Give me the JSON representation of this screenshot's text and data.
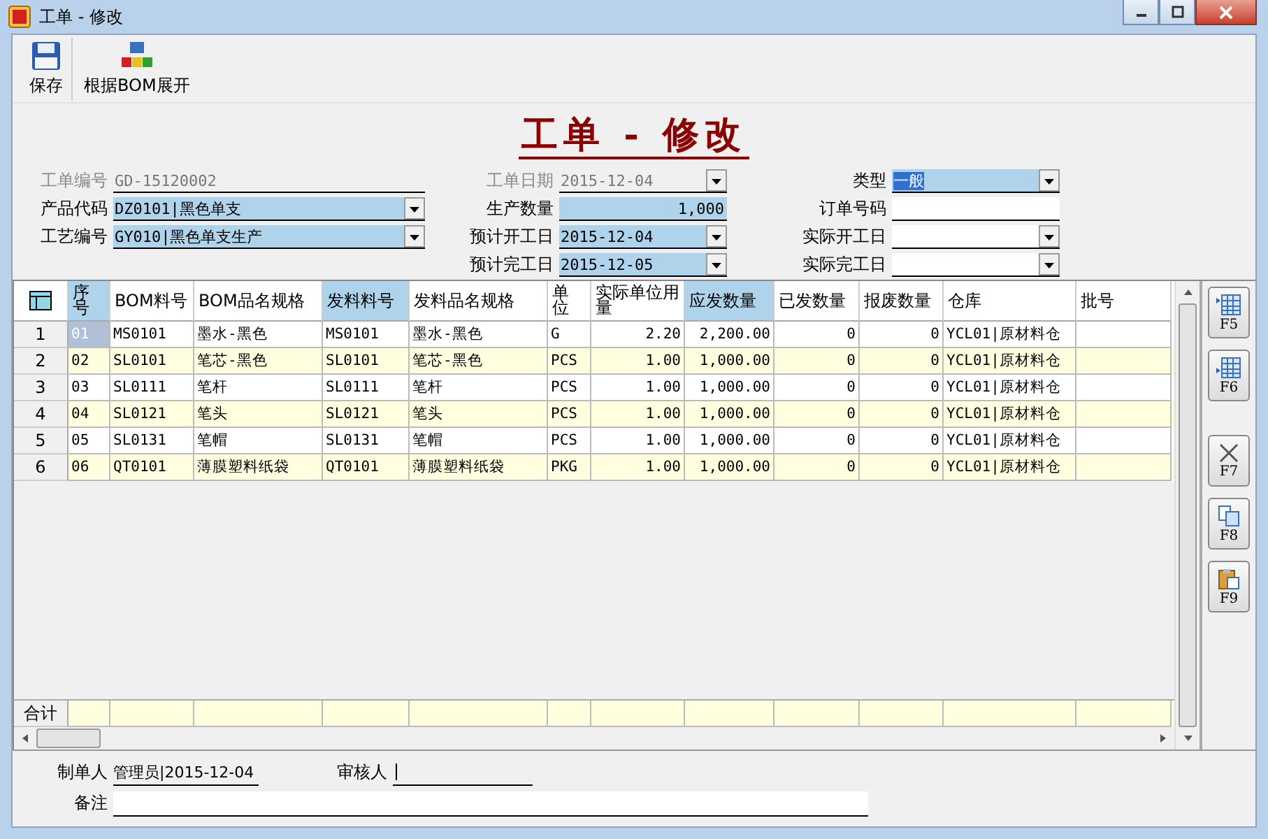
{
  "window": {
    "title": "工单 - 修改"
  },
  "toolbar": [
    {
      "label": "保存",
      "kind": "save"
    },
    {
      "label": "根据BOM展开",
      "kind": "blocks"
    }
  ],
  "form": {
    "title": "工单 - 修改",
    "columns": [
      [
        {
          "label": "工单编号",
          "value": "GD-15120002",
          "kind": "text",
          "disabled": true,
          "required": false,
          "value_selected": false
        },
        {
          "label": "产品代码",
          "value": "DZ0101|黑色单支",
          "kind": "combo",
          "disabled": false,
          "required": true,
          "value_selected": false
        },
        {
          "label": "工艺编号",
          "value": "GY010|黑色单支生产",
          "kind": "combo",
          "disabled": false,
          "required": true,
          "value_selected": false
        }
      ],
      [
        {
          "label": "工单日期",
          "value": "2015-12-04",
          "kind": "combo",
          "disabled": true,
          "required": false,
          "value_selected": false
        },
        {
          "label": "生产数量",
          "value": "1,000",
          "kind": "number",
          "disabled": false,
          "required": true,
          "value_selected": false
        },
        {
          "label": "预计开工日",
          "value": "2015-12-04",
          "kind": "combo",
          "disabled": false,
          "required": true,
          "value_selected": false
        },
        {
          "label": "预计完工日",
          "value": "2015-12-05",
          "kind": "combo",
          "disabled": false,
          "required": true,
          "value_selected": false
        }
      ],
      [
        {
          "label": "类型",
          "value": "一般",
          "kind": "combo",
          "disabled": false,
          "required": true,
          "value_selected": true
        },
        {
          "label": "订单号码",
          "kind": "text",
          "disabled": false,
          "required": false
        },
        {
          "label": "实际开工日",
          "kind": "combo",
          "disabled": false,
          "required": false
        },
        {
          "label": "实际完工日",
          "kind": "combo",
          "disabled": false,
          "required": false
        }
      ]
    ]
  },
  "grid": {
    "columns": [
      {
        "header": "序号",
        "highlighted": true
      },
      {
        "header": "BOM料号",
        "highlighted": false
      },
      {
        "header": "BOM品名规格",
        "highlighted": false
      },
      {
        "header": "发料料号",
        "highlighted": true
      },
      {
        "header": "发料品名规格",
        "highlighted": false
      },
      {
        "header": "单位",
        "highlighted": false
      },
      {
        "header": "实际单位用量",
        "highlighted": false
      },
      {
        "header": "应发数量",
        "highlighted": true
      },
      {
        "header": "已发数量",
        "highlighted": false
      },
      {
        "header": "报废数量",
        "highlighted": false
      },
      {
        "header": "仓库",
        "highlighted": false
      },
      {
        "header": "批号",
        "highlighted": false
      }
    ],
    "rows": [
      {
        "number": "1",
        "selected": true,
        "cells": [
          "01",
          "MS0101",
          "墨水-黑色",
          "MS0101",
          "墨水-黑色",
          "G",
          "2.20",
          "2,200.00",
          "0",
          "0",
          "YCL01|原材料仓",
          ""
        ]
      },
      {
        "number": "2",
        "selected": false,
        "cells": [
          "02",
          "SL0101",
          "笔芯-黑色",
          "SL0101",
          "笔芯-黑色",
          "PCS",
          "1.00",
          "1,000.00",
          "0",
          "0",
          "YCL01|原材料仓",
          ""
        ]
      },
      {
        "number": "3",
        "selected": false,
        "cells": [
          "03",
          "SL0111",
          "笔杆",
          "SL0111",
          "笔杆",
          "PCS",
          "1.00",
          "1,000.00",
          "0",
          "0",
          "YCL01|原材料仓",
          ""
        ]
      },
      {
        "number": "4",
        "selected": false,
        "cells": [
          "04",
          "SL0121",
          "笔头",
          "SL0121",
          "笔头",
          "PCS",
          "1.00",
          "1,000.00",
          "0",
          "0",
          "YCL01|原材料仓",
          ""
        ]
      },
      {
        "number": "5",
        "selected": false,
        "cells": [
          "05",
          "SL0131",
          "笔帽",
          "SL0131",
          "笔帽",
          "PCS",
          "1.00",
          "1,000.00",
          "0",
          "0",
          "YCL01|原材料仓",
          ""
        ]
      },
      {
        "number": "6",
        "selected": false,
        "cells": [
          "06",
          "QT0101",
          "薄膜塑料纸袋",
          "QT0101",
          "薄膜塑料纸袋",
          "PKG",
          "1.00",
          "1,000.00",
          "0",
          "0",
          "YCL01|原材料仓",
          ""
        ]
      }
    ],
    "total_label": "合计"
  },
  "side_buttons": [
    {
      "label": "F5",
      "kind": "insert"
    },
    {
      "label": "F6",
      "kind": "append"
    },
    {
      "label": "F7",
      "kind": "delete"
    },
    {
      "label": "F8",
      "kind": "copy"
    },
    {
      "label": "F9",
      "kind": "paste"
    }
  ],
  "footer": {
    "creator_label": "制单人",
    "creator": "管理员|2015-12-04",
    "reviewer_label": "审核人",
    "remark_label": "备注"
  }
}
